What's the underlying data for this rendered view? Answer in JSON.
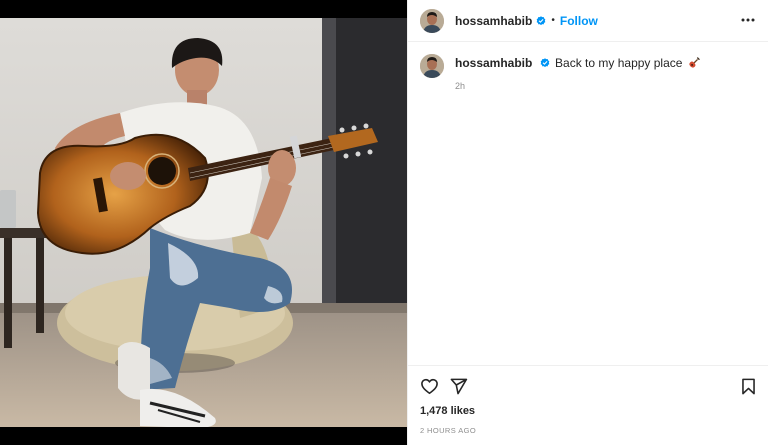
{
  "post": {
    "username": "hossamhabib",
    "verified": true,
    "follow_label": "Follow",
    "dot": "•",
    "caption": "Back to my happy place",
    "caption_emoji": "guitar-emoji",
    "caption_time": "2h",
    "likes": "1,478 likes",
    "timestamp": "2 HOURS AGO"
  },
  "icons": {
    "more": "more-options-icon",
    "like": "heart-icon",
    "share": "paper-plane-icon",
    "save": "bookmark-icon",
    "verified": "verified-badge-icon"
  },
  "colors": {
    "link": "#0095f6",
    "verified": "#0095f6",
    "text": "#262626",
    "muted": "#8e8e8e",
    "divider": "#efefef"
  }
}
